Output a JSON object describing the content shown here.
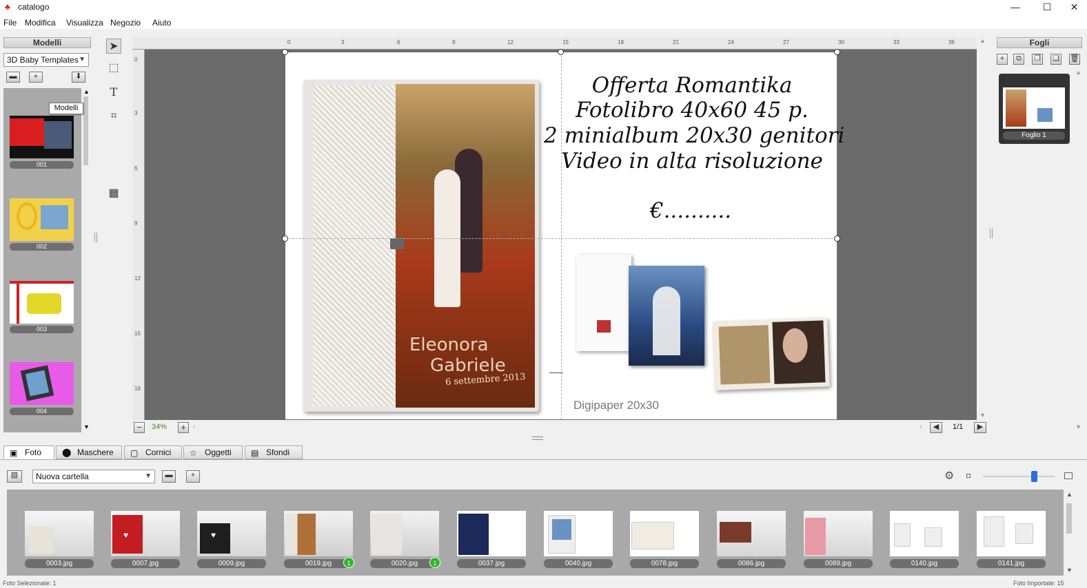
{
  "window": {
    "title": "catalogo",
    "minimize": "—",
    "maximize": "☐",
    "close": "✕"
  },
  "menu": [
    "File",
    "Modifica",
    "Visualizza",
    "Negozio",
    "Aiuto"
  ],
  "left_panel": {
    "header": "Modelli",
    "dropdown": "3D Baby Templates",
    "tooltip": "Modelli",
    "templates": [
      {
        "label": "001"
      },
      {
        "label": "002"
      },
      {
        "label": "003"
      },
      {
        "label": "004"
      }
    ]
  },
  "tools": [
    "select-tool-icon",
    "marquee-tool-icon",
    "text-tool-icon",
    "crop-tool-icon",
    "grid-tool-icon"
  ],
  "page": {
    "offer_lines": [
      "Offerta  Romantika",
      "Fotolibro 40x60 45 p.",
      "2 minialbum 20x30 genitori",
      "Video in alta risoluzione"
    ],
    "price": "€..........",
    "cover_name1": "Eleonora",
    "cover_name2": "Gabriele",
    "cover_date": "6 settembre 2013",
    "caption": "Digipaper 20x30"
  },
  "ruler": {
    "top": [
      "0",
      "3",
      "6",
      "9",
      "12",
      "15",
      "18",
      "21",
      "24",
      "27",
      "30",
      "33",
      "36"
    ],
    "left": [
      "0",
      "3",
      "6",
      "9",
      "12",
      "15",
      "18"
    ]
  },
  "zoom": {
    "value": "34%",
    "minus": "−",
    "plus": "+"
  },
  "pager": {
    "value": "1/1"
  },
  "right_panel": {
    "header": "Fogli",
    "sheet_label": "Foglio 1"
  },
  "tabs": [
    {
      "label": "Foto",
      "active": true
    },
    {
      "label": "Maschere"
    },
    {
      "label": "Cornici"
    },
    {
      "label": "Oggetti"
    },
    {
      "label": "Sfondi"
    }
  ],
  "photo_panel": {
    "folder": "Nuova cartella",
    "photos": [
      {
        "name": "0003.jpg"
      },
      {
        "name": "0007.jpg"
      },
      {
        "name": "0009.jpg"
      },
      {
        "name": "0019.jpg",
        "badge": "1"
      },
      {
        "name": "0020.jpg",
        "badge": "1"
      },
      {
        "name": "0037.jpg"
      },
      {
        "name": "0040.jpg"
      },
      {
        "name": "0078.jpg"
      },
      {
        "name": "0086.jpg"
      },
      {
        "name": "0089.jpg"
      },
      {
        "name": "0140.jpg"
      },
      {
        "name": "0141.jpg"
      }
    ]
  },
  "status": {
    "left": "Foto Selezionate: 1",
    "right": "Foto Importate: 15"
  },
  "colors": {
    "workspace": "#6b6b6b",
    "panel": "#a9a9a9",
    "badge": "#2fb52f"
  }
}
